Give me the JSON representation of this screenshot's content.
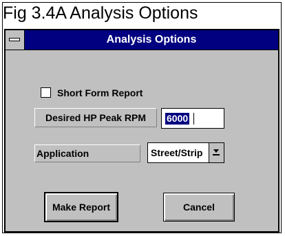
{
  "figure": {
    "caption": "Fig 3.4A  Analysis Options"
  },
  "window": {
    "title": "Analysis Options",
    "system_menu_icon": "system-menu-icon"
  },
  "short_form": {
    "label": "Short Form Report",
    "checked": false
  },
  "hp_peak": {
    "label": "Desired HP Peak RPM",
    "value": "6000"
  },
  "application": {
    "label": "Application",
    "selected": "Street/Strip",
    "dropdown_icon": "dropdown-arrow-icon"
  },
  "buttons": {
    "make_report": "Make Report",
    "cancel": "Cancel"
  }
}
